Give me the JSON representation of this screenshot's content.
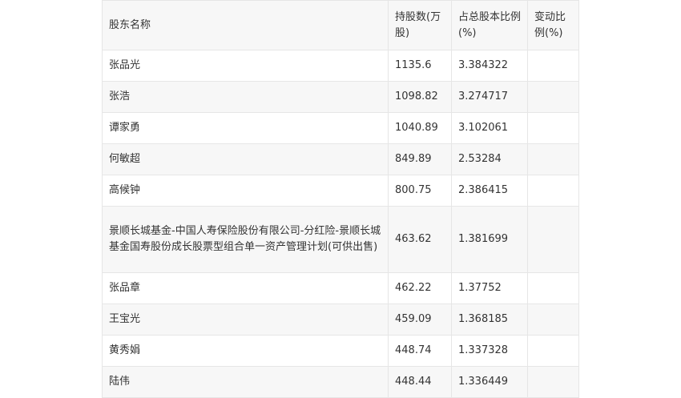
{
  "table": {
    "headers": [
      "股东名称",
      "持股数(万股)",
      "占总股本比例(%)",
      "变动比例(%)"
    ],
    "rows": [
      {
        "name": "张品光",
        "shares": "1135.6",
        "ratio": "3.384322",
        "change": ""
      },
      {
        "name": "张浩",
        "shares": "1098.82",
        "ratio": "3.274717",
        "change": ""
      },
      {
        "name": "谭家勇",
        "shares": "1040.89",
        "ratio": "3.102061",
        "change": ""
      },
      {
        "name": "何敏超",
        "shares": "849.89",
        "ratio": "2.53284",
        "change": ""
      },
      {
        "name": "高候钟",
        "shares": "800.75",
        "ratio": "2.386415",
        "change": ""
      },
      {
        "name": "景顺长城基金-中国人寿保险股份有限公司-分红险-景顺长城基金国寿股份成长股票型组合单一资产管理计划(可供出售)",
        "shares": "463.62",
        "ratio": "1.381699",
        "change": ""
      },
      {
        "name": "张品章",
        "shares": "462.22",
        "ratio": "1.37752",
        "change": ""
      },
      {
        "name": "王宝光",
        "shares": "459.09",
        "ratio": "1.368185",
        "change": ""
      },
      {
        "name": "黄秀娟",
        "shares": "448.74",
        "ratio": "1.337328",
        "change": ""
      },
      {
        "name": "陆伟",
        "shares": "448.44",
        "ratio": "1.336449",
        "change": ""
      }
    ]
  }
}
